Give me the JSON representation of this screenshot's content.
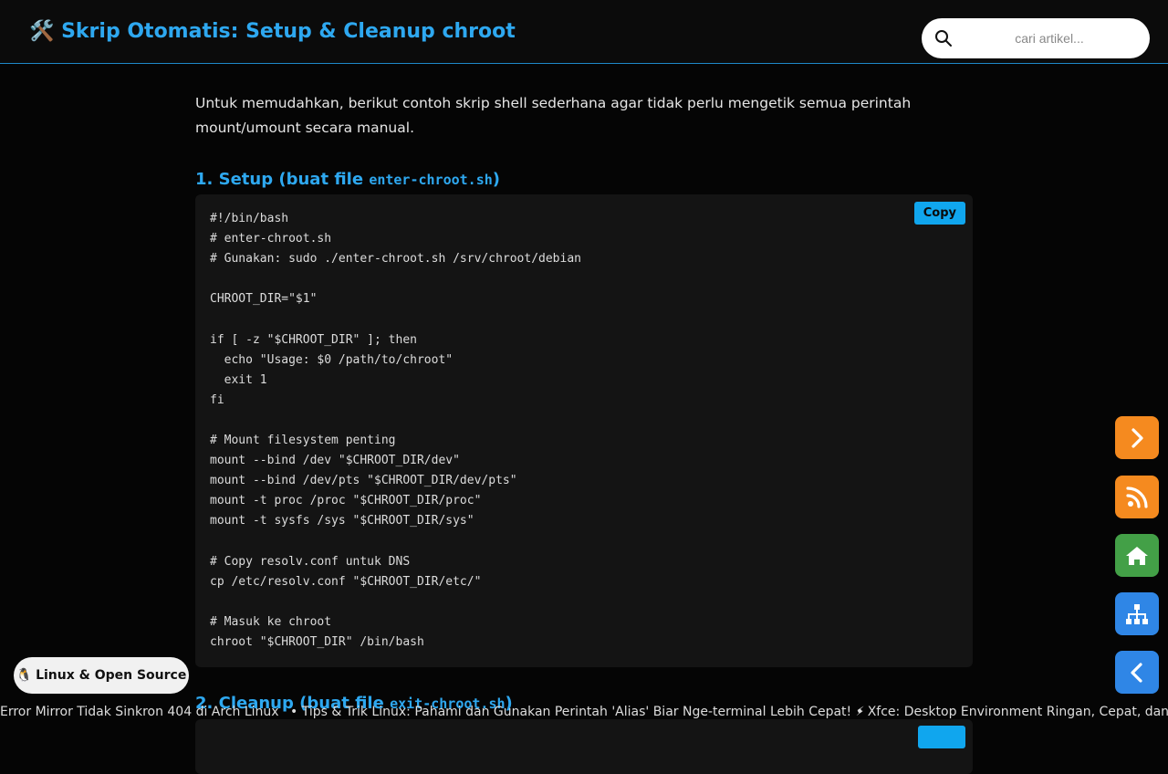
{
  "header": {
    "title_icon": "🛠️",
    "title": "Skrip Otomatis: Setup & Cleanup chroot",
    "search_placeholder": "cari artikel..."
  },
  "article": {
    "intro": "Untuk memudahkan, berikut contoh skrip shell sederhana agar tidak perlu mengetik semua perintah mount/umount secara manual.",
    "section1": {
      "prefix": "1. Setup (buat file ",
      "file": "enter-chroot.sh",
      "suffix": ")"
    },
    "section2": {
      "prefix": "2. Cleanup (buat file ",
      "file": "exit-chroot.sh",
      "suffix": ")"
    },
    "copy_label": "Copy",
    "code1": "#!/bin/bash\n# enter-chroot.sh\n# Gunakan: sudo ./enter-chroot.sh /srv/chroot/debian\n\nCHROOT_DIR=\"$1\"\n\nif [ -z \"$CHROOT_DIR\" ]; then\n  echo \"Usage: $0 /path/to/chroot\"\n  exit 1\nfi\n\n# Mount filesystem penting\nmount --bind /dev \"$CHROOT_DIR/dev\"\nmount --bind /dev/pts \"$CHROOT_DIR/dev/pts\"\nmount -t proc /proc \"$CHROOT_DIR/proc\"\nmount -t sysfs /sys \"$CHROOT_DIR/sys\"\n\n# Copy resolv.conf untuk DNS\ncp /etc/resolv.conf \"$CHROOT_DIR/etc/\"\n\n# Masuk ke chroot\nchroot \"$CHROOT_DIR\" /bin/bash"
  },
  "category_pill": {
    "icon": "🐧",
    "label": "Linux & Open Source"
  },
  "ticker": {
    "items": [
      "Error Mirror Tidak Sinkron 404 di Arch Linux",
      "Tips & Trik Linux: Pahami dan Gunakan Perintah 'Alias' Biar Nge-terminal Lebih Cepat! ⚡",
      "Xfce: Desktop Environment Ringan, Cepat, dan Stabil"
    ]
  },
  "colors": {
    "accent": "#2ea8f0",
    "fab_next": "#f58a1f",
    "fab_rss": "#f58a1f",
    "fab_home": "#43a047",
    "fab_sitemap": "#2f86e6",
    "fab_prev": "#2f86e6"
  },
  "icons": [
    "hammer-wrench-icon",
    "search-icon",
    "chevron-right-icon",
    "rss-icon",
    "home-icon",
    "sitemap-icon",
    "chevron-left-icon",
    "penguin-icon"
  ]
}
